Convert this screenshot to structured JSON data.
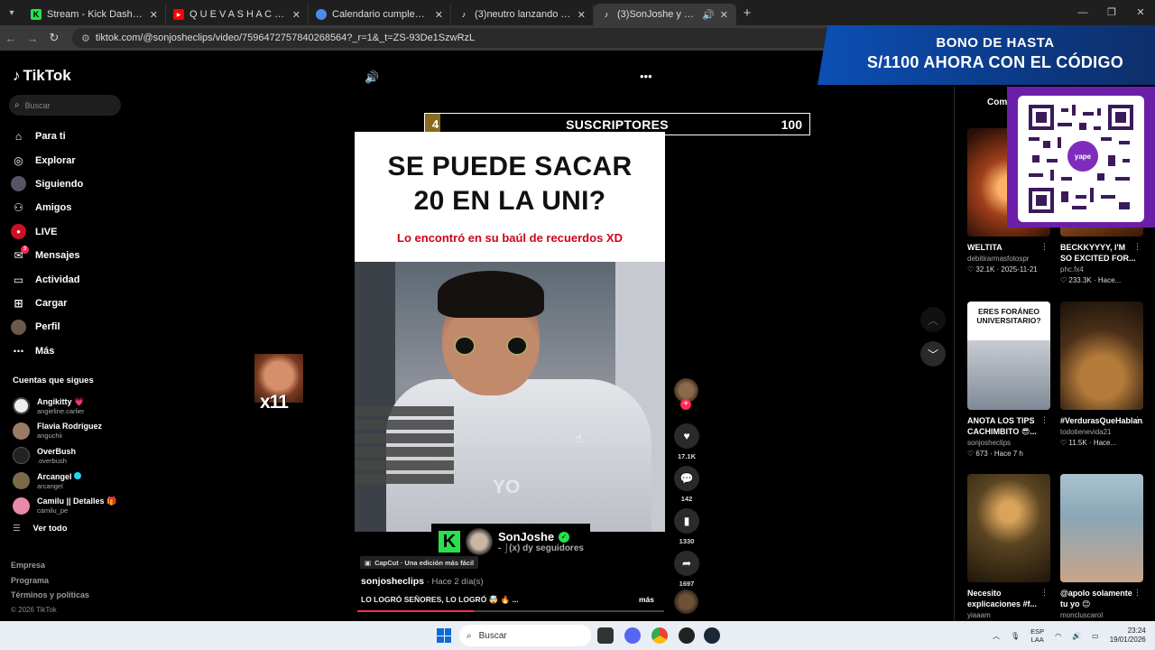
{
  "browser": {
    "tabs": [
      {
        "title": "Stream - Kick Dashboard",
        "favicon": "kick-icon",
        "active": false
      },
      {
        "title": "Q U E V A S H A C E R H O Y ?",
        "favicon": "youtube-icon",
        "active": false
      },
      {
        "title": "Calendario cumpleaños ilustrad",
        "favicon": "chrome-icon",
        "active": false
      },
      {
        "title": "(3)neutro lanzando factos #viral",
        "favicon": "tiktok-icon",
        "active": false
      },
      {
        "title": "(3)SonJoshe y su locura dia",
        "favicon": "tiktok-icon",
        "active": true
      }
    ],
    "url": "tiktok.com/@sonjosheclips/video/7596472757840268564?_r=1&_t=ZS-93De1SzwRzL"
  },
  "sidebar": {
    "logo": "TikTok",
    "search_placeholder": "Buscar",
    "nav": [
      {
        "label": "Para ti",
        "icon": "home-icon"
      },
      {
        "label": "Explorar",
        "icon": "compass-icon"
      },
      {
        "label": "Siguiendo",
        "icon": "avatar-icon"
      },
      {
        "label": "Amigos",
        "icon": "friends-icon"
      },
      {
        "label": "LIVE",
        "icon": "live-icon"
      },
      {
        "label": "Mensajes",
        "icon": "message-icon",
        "badge": "3"
      },
      {
        "label": "Actividad",
        "icon": "activity-icon"
      },
      {
        "label": "Cargar",
        "icon": "upload-icon"
      },
      {
        "label": "Perfil",
        "icon": "profile-icon"
      },
      {
        "label": "Más",
        "icon": "more-icon"
      }
    ],
    "following_title": "Cuentas que sigues",
    "following": [
      {
        "name": "Angikitty 💗",
        "handle": "angieline.carlier",
        "color": "#eeeeee"
      },
      {
        "name": "Flavia Rodríguez",
        "handle": "anguchii",
        "color": "#9c7b66"
      },
      {
        "name": "OverBush",
        "handle": ".overbush",
        "color": "#222222"
      },
      {
        "name": "Arcangel",
        "handle": "arcangel",
        "color": "#7a6a4a",
        "verified": true
      },
      {
        "name": "Camilu || Detalles 🎁",
        "handle": "camilu_pe",
        "color": "#e88aa8"
      }
    ],
    "see_all": "Ver todo",
    "footer": [
      "Empresa",
      "Programa",
      "Términos y políticas"
    ],
    "copyright": "© 2026 TikTok"
  },
  "video": {
    "overlay_counter": {
      "current": "4",
      "label": "SUSCRIPTORES",
      "goal": "100",
      "progress": 0.04
    },
    "headline_line1": "SE PUEDE SACAR",
    "headline_line2": "20 EN LA UNI?",
    "subheadline": "Lo encontró en su baúl de recuerdos XD",
    "on_video_text": "YO",
    "meme_text": "x11",
    "channel": {
      "name": "SonJoshe",
      "followers": "- ⌡(x) dy seguidores"
    },
    "capcut_label": "CapCut · Una edición más fácil",
    "author": "sonjosheclips",
    "posted": " · Hace 2 día(s)",
    "caption": "LO LOGRÓ SEÑORES, LO LOGRÓ 🤯 🔥 ...",
    "more": "más",
    "playback_progress": 0.38,
    "stats": {
      "likes": "17.1K",
      "comments": "142",
      "saves": "1330",
      "shares": "1697"
    }
  },
  "right_panel": {
    "tab": "Come",
    "ad": {
      "line1": "BONO DE HASTA",
      "line2": "S/1100 AHORA CON EL CÓDIGO",
      "qr_brand": "yape"
    },
    "videos": [
      {
        "title": "WELTITA",
        "author": "debitirarmasfotospr",
        "stats": "♡ 32.1K · 2025-11-21",
        "color": "#8a3a1a"
      },
      {
        "title": "BECKKYYYY, I'M SO EXCITED FOR...",
        "author": "phc.fx4",
        "stats": "♡ 233.3K · Hace...",
        "color": "#5a2a14"
      },
      {
        "title": "ANOTA LOS TIPS CACHIMBITO 😎...",
        "author": "sonjosheclips",
        "stats": "♡ 673 · Hace 7 h",
        "color": "#d9dde3",
        "thumb_text": "ERES FORÁNEO UNIVERSITARIO?"
      },
      {
        "title": "#VerdurasQueHablan...",
        "author": "todotienevida21",
        "stats": "♡ 11.5K · Hace...",
        "color": "#6b4a22"
      },
      {
        "title": "Necesito explicaciones #f...",
        "author": "yiaaam",
        "stats": "",
        "color": "#5a4a2a"
      },
      {
        "title": "@apolo solamente tu yo 😊",
        "author": "moncluscarol",
        "stats": "",
        "color": "#8aa6b5"
      }
    ]
  },
  "taskbar": {
    "search_placeholder": "Buscar",
    "lang1": "ESP",
    "lang2": "LAA",
    "time": "23:24",
    "date": "19/01/2026"
  }
}
